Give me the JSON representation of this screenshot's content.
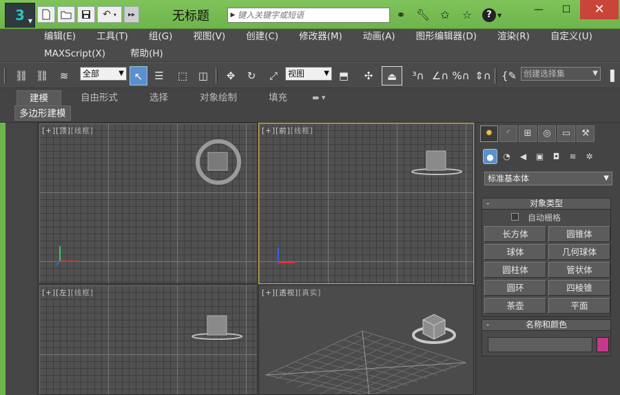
{
  "titlebar": {
    "document_title": "无标题",
    "search_placeholder": "键入关键字或短语",
    "quick_access": {
      "new_icon": "new-file-icon",
      "open_icon": "open-folder-icon",
      "save_icon": "save-icon",
      "undo_icon": "undo-icon",
      "overflow_icon": "overflow-icon"
    },
    "tools": [
      "binoculars-icon",
      "wrench-icon",
      "star-crossed-icon",
      "favorite-star-icon"
    ],
    "help_icon": "help-icon",
    "window_controls": {
      "minimize": "minimize-icon",
      "maximize": "maximize-icon",
      "close": "close-icon"
    }
  },
  "menu": {
    "row1": [
      "编辑(E)",
      "工具(T)",
      "组(G)",
      "视图(V)",
      "创建(C)",
      "修改器(M)",
      "动画(A)",
      "图形编辑器(D)",
      "渲染(R)",
      "自定义(U)"
    ],
    "row2": [
      "MAXScript(X)",
      "帮助(H)"
    ]
  },
  "main_toolbar": {
    "selection_filter": "全部",
    "reference_coord": "视图",
    "named_selection": "创建选择集"
  },
  "ribbon": {
    "tabs": [
      "建模",
      "自由形式",
      "选择",
      "对象绘制",
      "填充"
    ],
    "active_tab": "建模",
    "panel_button": "多边形建模"
  },
  "viewports": {
    "top": {
      "label": "[+]",
      "view": "[顶]",
      "shading": "[线框]"
    },
    "front": {
      "label": "[+]",
      "view": "[前]",
      "shading": "[线框]"
    },
    "left": {
      "label": "[+]",
      "view": "[左]",
      "shading": "[线框]"
    },
    "perspective": {
      "label": "[+]",
      "view": "[透视]",
      "shading": "[真实]"
    }
  },
  "command_panel": {
    "category": "标准基本体",
    "object_type": {
      "title": "对象类型",
      "autogrid_label": "自动栅格",
      "buttons": [
        "长方体",
        "圆锥体",
        "球体",
        "几何球体",
        "圆柱体",
        "管状体",
        "圆环",
        "四棱锥",
        "茶壶",
        "平面"
      ]
    },
    "name_color": {
      "title": "名称和颜色",
      "name_value": "",
      "color": "#c8388a"
    }
  },
  "colors": {
    "title_green": "#6fb44c",
    "panel_gray": "#444444",
    "active_blue": "#5c8fcf",
    "active_viewport_border": "#c9a34a",
    "close_red": "#c9453a"
  }
}
